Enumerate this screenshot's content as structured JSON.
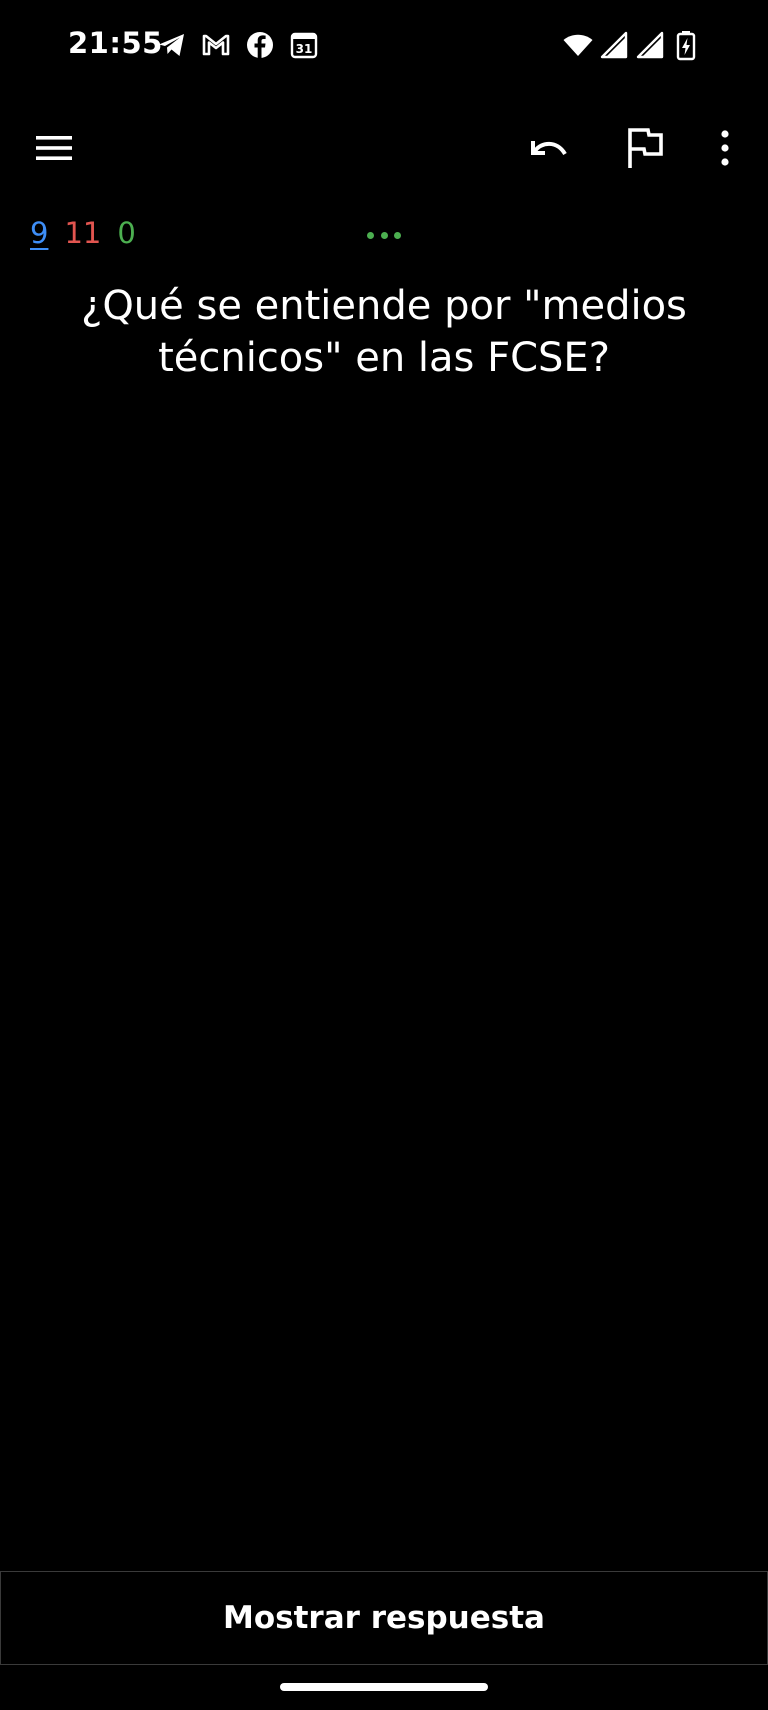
{
  "status_bar": {
    "time": "21:55",
    "left_icons": [
      "telegram-icon",
      "gmail-icon",
      "facebook-icon",
      "calendar-icon"
    ],
    "calendar_day": "31",
    "right_icons": [
      "wifi-icon",
      "signal-icon",
      "signal-icon",
      "battery-charging-icon"
    ]
  },
  "toolbar": {
    "icons": [
      "menu-icon",
      "undo-icon",
      "flag-icon",
      "more-vert-icon"
    ]
  },
  "counts": {
    "new": "9",
    "learning": "11",
    "review": "0"
  },
  "question": {
    "text": "¿Qué se entiende por \"medios técnicos\" en las FCSE?"
  },
  "answer_button": {
    "label": "Mostrar respuesta"
  },
  "colors": {
    "background": "#000000",
    "new_count": "#3e8ef7",
    "learning_count": "#e25550",
    "review_count": "#4caf50",
    "text": "#ffffff"
  }
}
